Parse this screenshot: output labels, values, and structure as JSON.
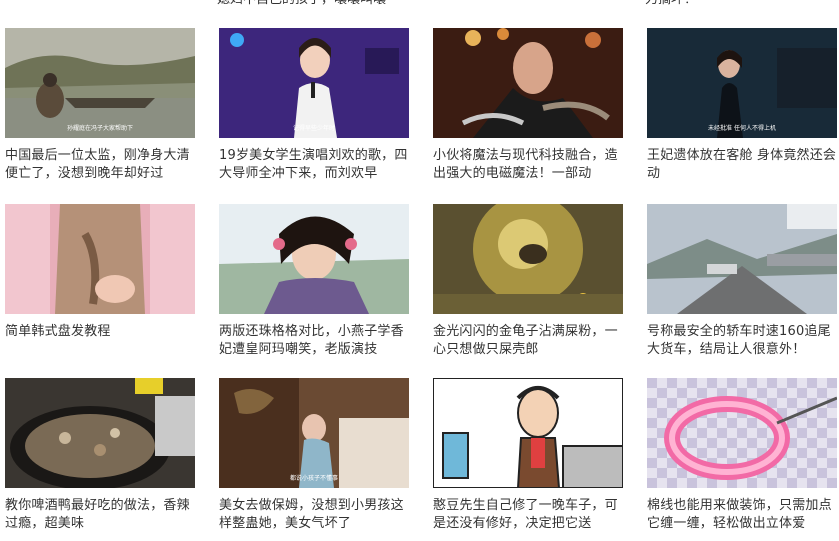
{
  "top_row": [
    {
      "title": "媳妇不自己的孩子，嚷嚷叫嚷"
    },
    {
      "title": "力搞坏！"
    }
  ],
  "videos": [
    {
      "title": "中国最后一位太监，刚净身大清便亡了，没想到晚年却好过",
      "caption": "孙耀庭在冯子大家帮助下"
    },
    {
      "title": "19岁美女学生演唱刘欢的歌，四大导师全冲下来，而刘欢早",
      "caption": "记得早些少年时"
    },
    {
      "title": "小伙将魔法与现代科技融合，造出强大的电磁魔法！一部动",
      "caption": ""
    },
    {
      "title": "王妃遗体放在客舱 身体竟然还会动",
      "caption": "未经批准 任何人不得上机"
    },
    {
      "title": "简单韩式盘发教程",
      "caption": ""
    },
    {
      "title": "两版还珠格格对比，小燕子学香妃遭皇阿玛嘲笑，老版演技",
      "caption": ""
    },
    {
      "title": "金光闪闪的金龟子沾满屎粉，一心只想做只屎壳郎",
      "caption": ""
    },
    {
      "title": "号称最安全的轿车时速160追尾大货车，结局让人很意外！",
      "caption": ""
    },
    {
      "title": "教你啤酒鸭最好吃的做法，香辣过瘾，超美味",
      "caption": ""
    },
    {
      "title": "美女去做保姆，没想到小男孩这样整蛊她，美女气坏了",
      "caption": "都说小孩子不懂事"
    },
    {
      "title": "憨豆先生自己修了一晚车子，可是还没有修好，决定把它送",
      "caption": ""
    },
    {
      "title": "棉线也能用来做装饰，只需加点它缠一缠，轻松做出立体爱",
      "caption": ""
    }
  ],
  "colors": {
    "text": "#333333",
    "background": "#ffffff"
  }
}
